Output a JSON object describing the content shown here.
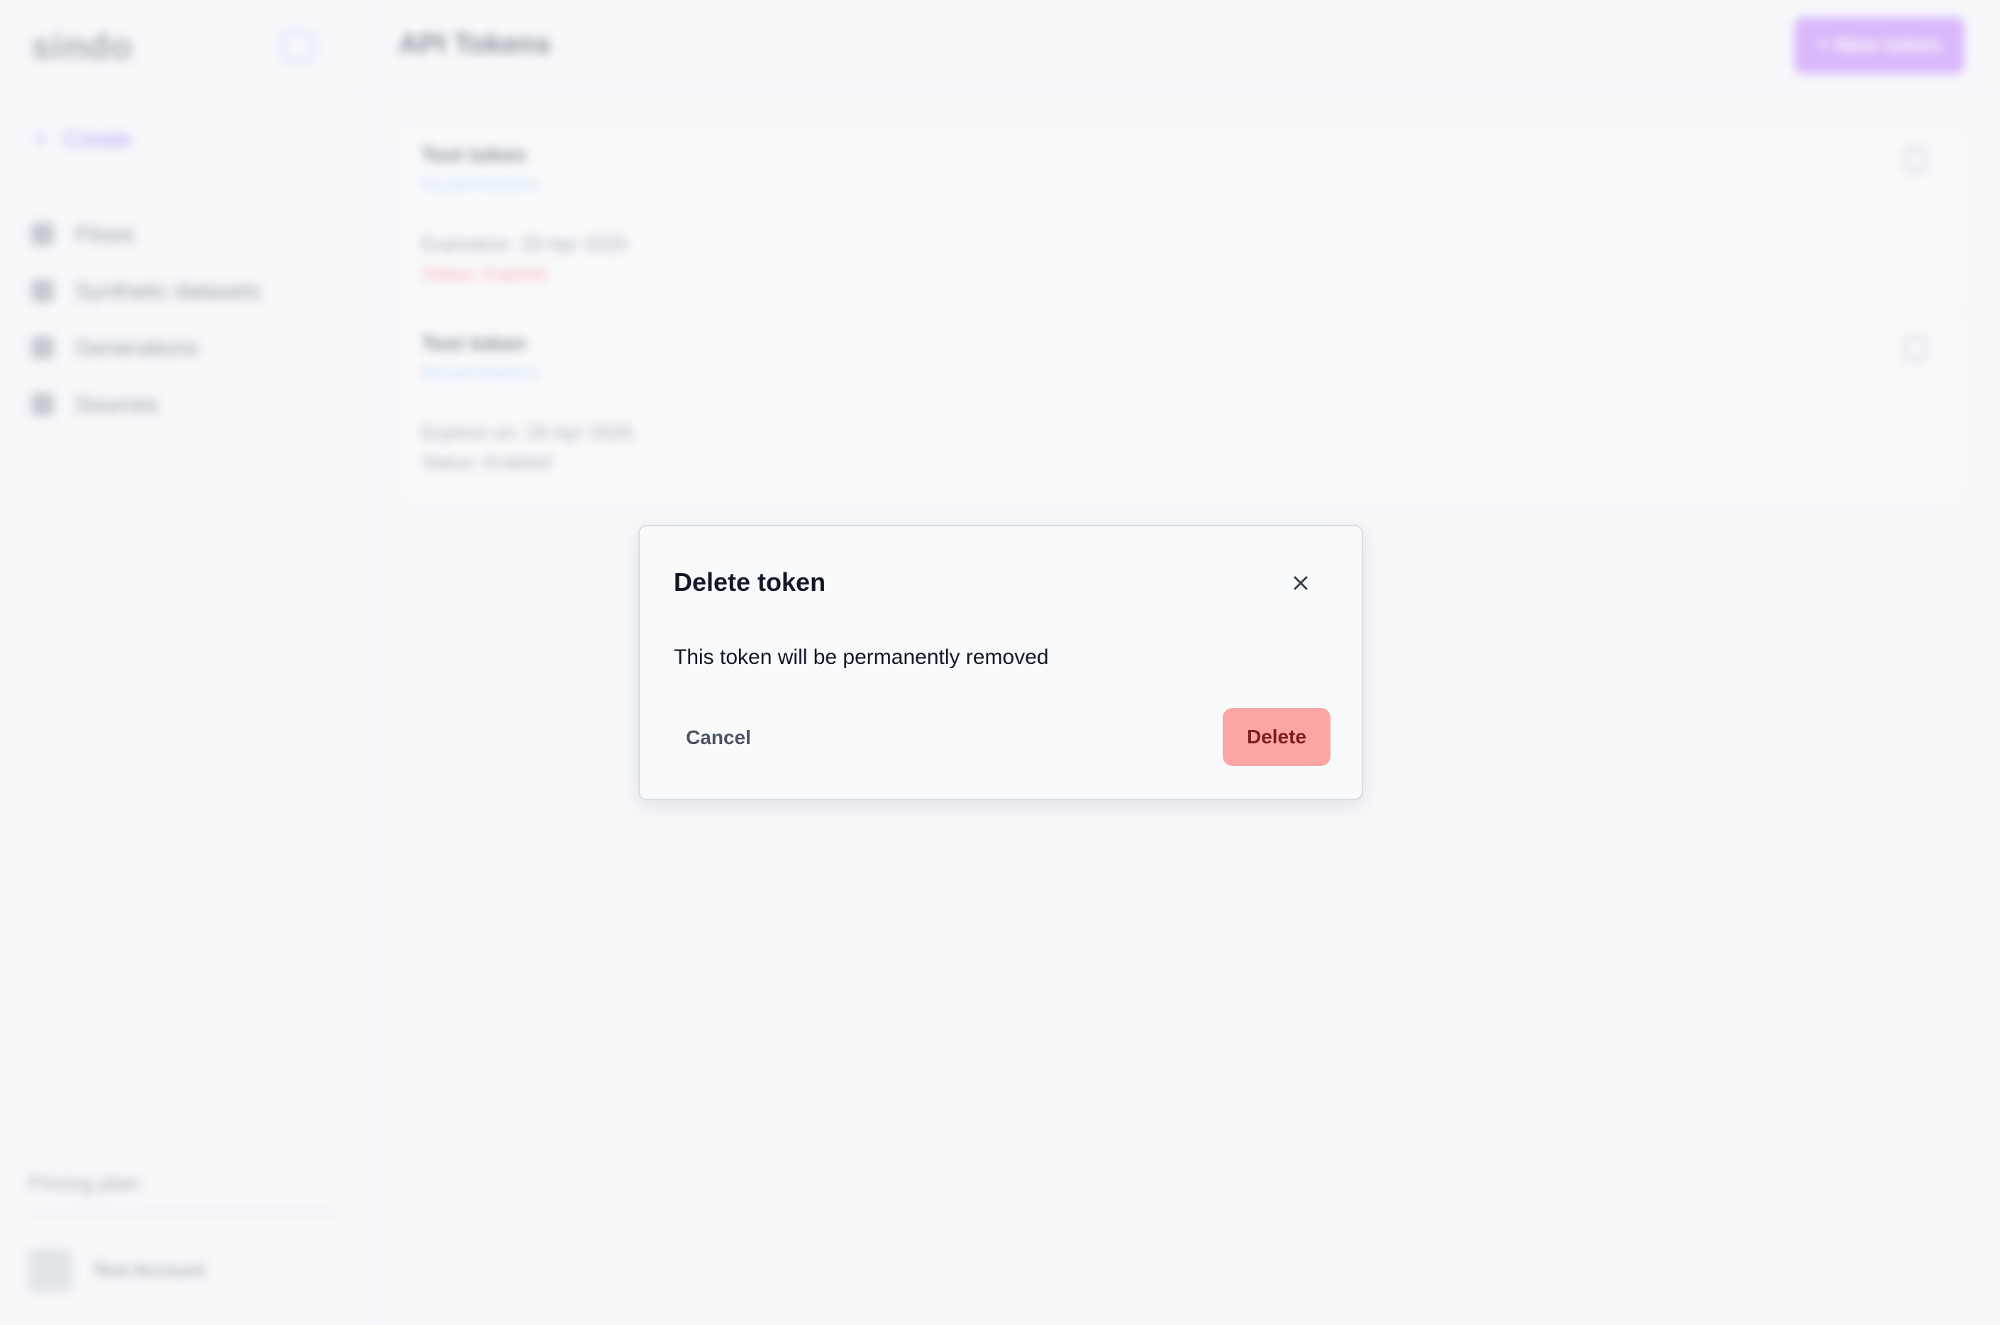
{
  "sidebar": {
    "logo": "sindo",
    "create_label": "Create",
    "items": [
      {
        "label": "Flows",
        "icon": "grid-icon"
      },
      {
        "label": "Synthetic datasets",
        "icon": "person-icon"
      },
      {
        "label": "Generations",
        "icon": "rocket-icon"
      },
      {
        "label": "Sources",
        "icon": "globe-icon"
      }
    ],
    "pricing_label": "Pricing plan",
    "user_name": "Test Account"
  },
  "header": {
    "title": "API Tokens",
    "new_token_label": "+ New token"
  },
  "tokens": [
    {
      "name": "Test token",
      "permissions": "No permissions",
      "expiration": "Expiration: 29 Apr 2025",
      "status": "Status: Expired",
      "status_color": "#f87171"
    },
    {
      "name": "Test token",
      "permissions": "No permissions",
      "expiration": "Expires on: 25 Apr 2025",
      "status": "Status: Enabled",
      "status_color": "#6b7280"
    }
  ],
  "modal": {
    "title": "Delete token",
    "body": "This token will be permanently removed",
    "cancel_label": "Cancel",
    "delete_label": "Delete",
    "close_icon": "close-icon",
    "danger_color": "#fca5a5"
  }
}
